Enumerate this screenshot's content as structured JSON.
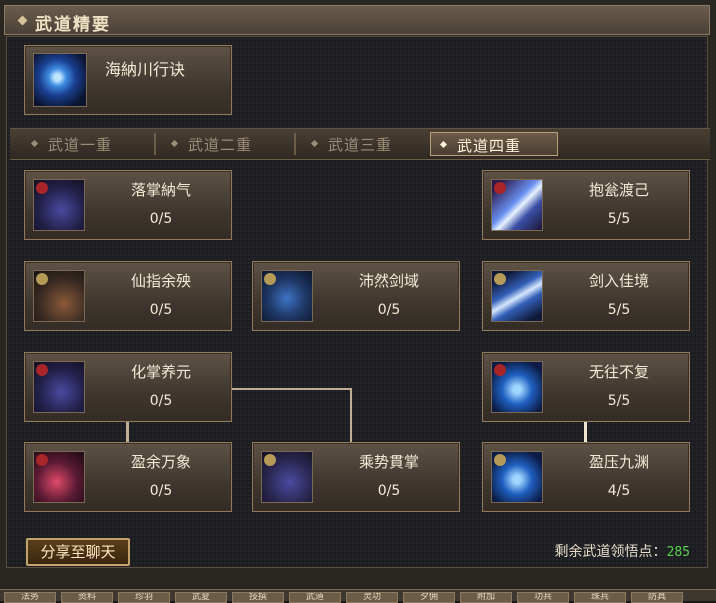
{
  "window": {
    "title": "武道精要"
  },
  "main_skill": {
    "name": "海納川行诀",
    "icon": "warrior-blue-aura-icon"
  },
  "tabs": [
    {
      "label": "武道一重",
      "active": false
    },
    {
      "label": "武道二重",
      "active": false
    },
    {
      "label": "武道三重",
      "active": false
    },
    {
      "label": "武道四重",
      "active": true
    }
  ],
  "skills": [
    {
      "name": "落掌納气",
      "count": "0/5",
      "icon": "palm-strike-icon",
      "color": "#2c2a55"
    },
    {
      "name": "抱瓮渡己",
      "count": "5/5",
      "icon": "blue-blade-icon",
      "color": "#3b4fa5"
    },
    {
      "name": "仙指余殃",
      "count": "0/5",
      "icon": "finger-point-icon",
      "color": "#3a2a22"
    },
    {
      "name": "沛然剑域",
      "count": "0/5",
      "icon": "sword-domain-icon",
      "color": "#1f3866"
    },
    {
      "name": "剑入佳境",
      "count": "5/5",
      "icon": "spear-icon",
      "color": "#3360b8"
    },
    {
      "name": "化掌养元",
      "count": "0/5",
      "icon": "palm-strike-icon",
      "color": "#2c2a55"
    },
    {
      "name": "无往不复",
      "count": "5/5",
      "icon": "blue-warrior-icon",
      "color": "#1f5fc0"
    },
    {
      "name": "盈余万象",
      "count": "0/5",
      "icon": "red-flame-icon",
      "color": "#5a1a33"
    },
    {
      "name": "乘势貫掌",
      "count": "0/5",
      "icon": "palm-strike-icon",
      "color": "#2a2650"
    },
    {
      "name": "盈压九渊",
      "count": "4/5",
      "icon": "blue-warrior-icon",
      "color": "#1f5fc0"
    }
  ],
  "share_button": {
    "label": "分享至聊天"
  },
  "remaining": {
    "label": "剩余武道领悟点：",
    "value": "285"
  },
  "bottom_tabs": [
    "法务",
    "资料",
    "珍羽",
    "武夏",
    "技撰",
    "武道",
    "灵功",
    "夕佣",
    "附加",
    "功兵",
    "珠兵",
    "防具"
  ]
}
